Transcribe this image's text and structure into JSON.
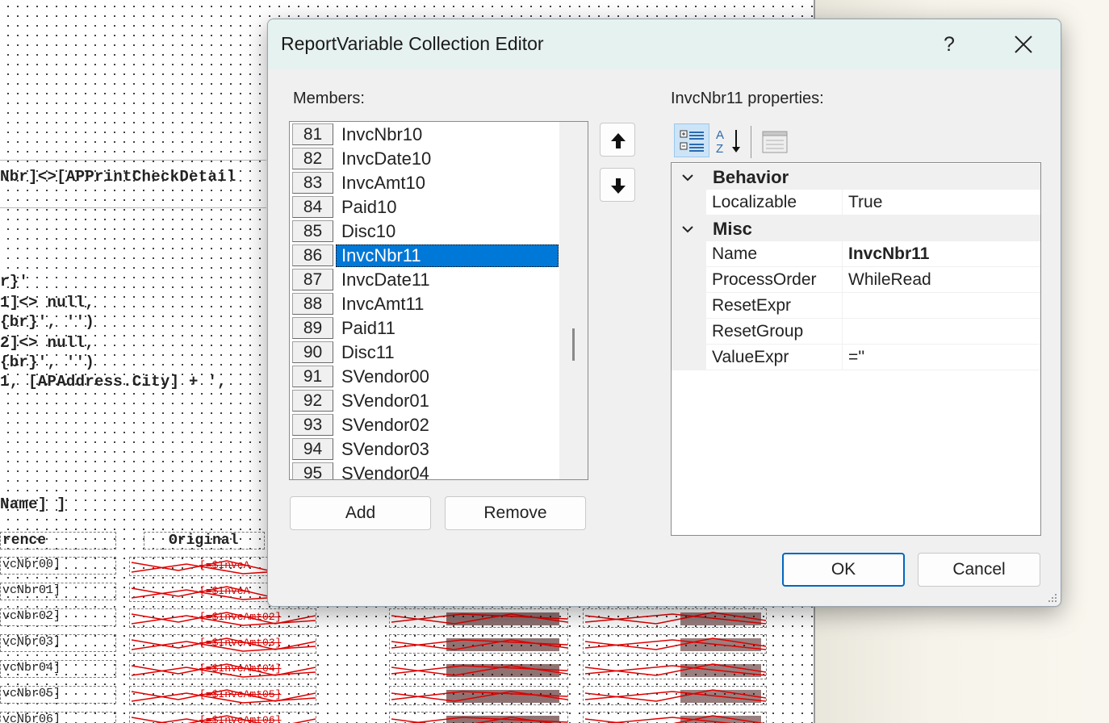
{
  "background": {
    "code_lines": [
      "Nbr]<>[APPrintCheckDetail",
      "r}'",
      "1]<> null,",
      "{br}', '')",
      "2]<> null,",
      "{br}', '')",
      "1, [APAddress.City] + ',",
      "Name] ]"
    ],
    "header_ref": "rence",
    "header_original": "Original",
    "invoice_cells": [
      "vcNbr00]",
      "vcNbr01]",
      "vcNbr02]",
      "vcNbr03]",
      "vcNbr04]",
      "vcNbr05]",
      "vcNbr06]"
    ],
    "amt_cells": [
      "[=$InvcA",
      "[=$InvcA",
      "[=$InvcAmt02]",
      "[=$InvcAmt03]",
      "[=$InvcAmt04]",
      "[=$InvcAmt05]",
      "[=$InvcAmt06]"
    ]
  },
  "dialog": {
    "title": "ReportVariable Collection Editor",
    "help_label": "?",
    "members_label": "Members:",
    "members": [
      {
        "index": "81",
        "name": "InvcNbr10"
      },
      {
        "index": "82",
        "name": "InvcDate10"
      },
      {
        "index": "83",
        "name": "InvcAmt10"
      },
      {
        "index": "84",
        "name": "Paid10"
      },
      {
        "index": "85",
        "name": "Disc10"
      },
      {
        "index": "86",
        "name": "InvcNbr11"
      },
      {
        "index": "87",
        "name": "InvcDate11"
      },
      {
        "index": "88",
        "name": "InvcAmt11"
      },
      {
        "index": "89",
        "name": "Paid11"
      },
      {
        "index": "90",
        "name": "Disc11"
      },
      {
        "index": "91",
        "name": "SVendor00"
      },
      {
        "index": "92",
        "name": "SVendor01"
      },
      {
        "index": "93",
        "name": "SVendor02"
      },
      {
        "index": "94",
        "name": "SVendor03"
      },
      {
        "index": "95",
        "name": "SVendor04"
      }
    ],
    "selected_member": "InvcNbr11",
    "add_label": "Add",
    "remove_label": "Remove",
    "properties_label": "InvcNbr11 properties:",
    "categories": [
      {
        "name": "Behavior",
        "props": [
          {
            "name": "Localizable",
            "value": "True"
          }
        ]
      },
      {
        "name": "Misc",
        "props": [
          {
            "name": "Name",
            "value": "InvcNbr11"
          },
          {
            "name": "ProcessOrder",
            "value": "WhileRead"
          },
          {
            "name": "ResetExpr",
            "value": ""
          },
          {
            "name": "ResetGroup",
            "value": ""
          },
          {
            "name": "ValueExpr",
            "value": "=''"
          }
        ]
      }
    ],
    "ok_label": "OK",
    "cancel_label": "Cancel",
    "colors": {
      "selection": "#0078d7",
      "titlebar": "#e6f2f0",
      "primary_border": "#0067c0"
    },
    "icons": [
      "close-icon",
      "arrow-up-icon",
      "arrow-down-icon",
      "categorized-icon",
      "sort-alpha-icon",
      "property-pages-icon",
      "chevron-down-icon",
      "resize-grip-icon"
    ]
  }
}
